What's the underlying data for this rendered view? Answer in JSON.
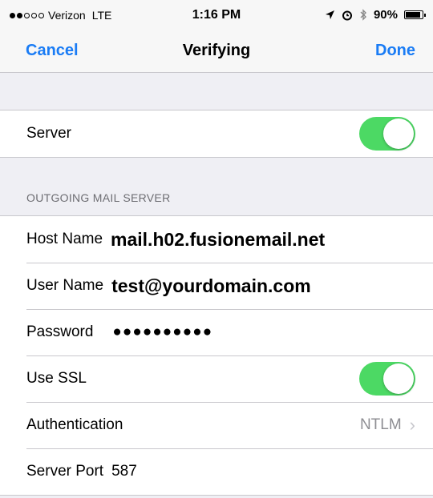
{
  "status": {
    "carrier": "Verizon",
    "network": "LTE",
    "time": "1:16 PM",
    "battery": "90%",
    "battery_level": 0.9,
    "signal_bars": 2,
    "icons": [
      "location-arrow-icon",
      "alarm-icon",
      "bluetooth-icon",
      "battery-icon"
    ]
  },
  "nav": {
    "cancel": "Cancel",
    "title": "Verifying",
    "done": "Done"
  },
  "server_toggle": {
    "label": "Server",
    "on": true
  },
  "outgoing": {
    "header": "OUTGOING MAIL SERVER",
    "host_label": "Host Name",
    "host_value": "mail.h02.fusionemail.net",
    "user_label": "User Name",
    "user_value": "test@yourdomain.com",
    "password_label": "Password",
    "password_value": "●●●●●●●●●●",
    "ssl_label": "Use SSL",
    "ssl_on": true,
    "auth_label": "Authentication",
    "auth_value": "NTLM",
    "port_label": "Server Port",
    "port_value": "587"
  },
  "colors": {
    "accent": "#1a7cf5",
    "toggle_on": "#4cd964",
    "background": "#efeff4",
    "secondary_text": "#8e8e93"
  }
}
